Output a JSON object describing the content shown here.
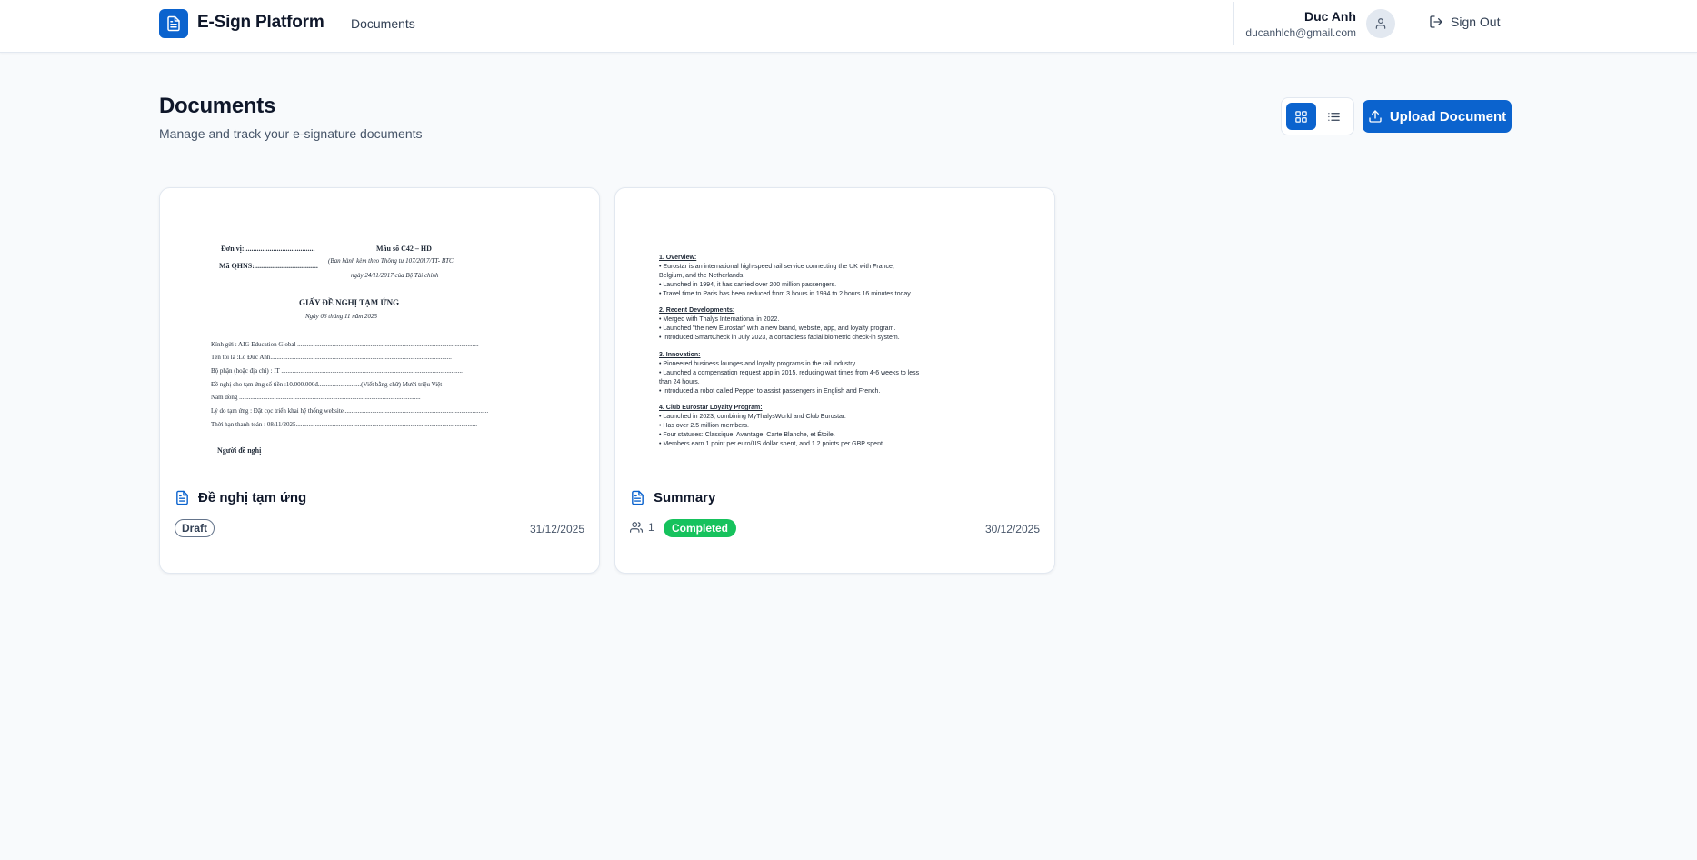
{
  "header": {
    "brand": "E-Sign Platform",
    "nav_documents": "Documents",
    "user_name": "Duc Anh",
    "user_email": "ducanhlch@gmail.com",
    "sign_out": "Sign Out"
  },
  "page": {
    "title": "Documents",
    "subtitle": "Manage and track your e-signature documents",
    "upload_label": "Upload Document"
  },
  "documents": [
    {
      "title": "Đề nghị tạm ứng",
      "status": "Draft",
      "date": "31/12/2025",
      "preview": {
        "unit": "Đơn vị:.......................................",
        "code": "Mã QHNS:...................................",
        "form_no": "Mẫu số C42 – HD",
        "issued_1": "(Ban hành kèm theo Thông tư 107/2017/TT- BTC",
        "issued_2": "ngày 24/11/2017 của Bộ Tài chính",
        "heading": "GIẤY ĐỀ NGHỊ TẠM ỨNG",
        "dated": "Ngày 06 tháng 11 năm 2025",
        "lines": [
          "Kính gửi : AIG Education Global ..................................................................................................................",
          "Tên tôi là :Lò Đức Anh..................................................................................................................",
          "Bộ phận (hoặc địa chỉ) : IT ..................................................................................................................",
          "Đề nghị cho tạm ứng số tiền :10.000.000đ...........................(Viết bằng chữ) Mười triệu Việt",
          "Nam đồng ..................................................................................................................",
          "Lý do tạm ứng : Đặt cọc triển khai hệ thống website..................................................................................................................",
          "Thời hạn thanh toán : 08/11/2025..................................................................................................................",
          "Người đề nghị"
        ]
      }
    },
    {
      "title": "Summary",
      "status": "Completed",
      "date": "30/12/2025",
      "signers": "1",
      "preview": {
        "lines": [
          {
            "text": "1. Overview:",
            "h": true
          },
          {
            "text": "• Eurostar is an international high-speed rail service connecting the UK with France,",
            "h": false
          },
          {
            "text": "Belgium, and the Netherlands.",
            "h": false
          },
          {
            "text": "• Launched in 1994, it has carried over 200 million passengers.",
            "h": false
          },
          {
            "text": "• Travel time to Paris has been reduced from 3 hours in 1994 to 2 hours 16 minutes today.",
            "h": false
          },
          {
            "text": "",
            "h": false
          },
          {
            "text": "2. Recent Developments:",
            "h": true
          },
          {
            "text": "• Merged with Thalys International in 2022.",
            "h": false
          },
          {
            "text": "• Launched \"the new Eurostar\" with a new brand, website, app, and loyalty program.",
            "h": false
          },
          {
            "text": "• Introduced SmartCheck in July 2023, a contactless facial biometric check-in system.",
            "h": false
          },
          {
            "text": "",
            "h": false
          },
          {
            "text": "3. Innovation:",
            "h": true
          },
          {
            "text": "• Pioneered business lounges and loyalty programs in the rail industry.",
            "h": false
          },
          {
            "text": "• Launched a compensation request app in 2015, reducing wait times from 4-6 weeks to less",
            "h": false
          },
          {
            "text": "than 24 hours.",
            "h": false
          },
          {
            "text": "• Introduced a robot called Pepper to assist passengers in English and French.",
            "h": false
          },
          {
            "text": "",
            "h": false
          },
          {
            "text": "4. Club Eurostar Loyalty Program:",
            "h": true
          },
          {
            "text": "• Launched in 2023, combining MyThalysWorld and Club Eurostar.",
            "h": false
          },
          {
            "text": "• Has over 2.5 million members.",
            "h": false
          },
          {
            "text": "• Four statuses: Classique, Avantage, Carte Blanche, et Étoile.",
            "h": false
          },
          {
            "text": "• Members earn 1 point per euro/US dollar spent, and 1.2 points per GBP spent.",
            "h": false
          }
        ]
      }
    }
  ],
  "icons": {
    "logo": "document-icon",
    "avatar": "user-icon",
    "sign_out": "logout-icon",
    "grid_view": "grid-icon",
    "list_view": "list-icon",
    "upload": "upload-icon",
    "file": "file-text-icon",
    "signers": "users-icon"
  },
  "colors": {
    "primary": "#0b63ce",
    "completed": "#16c25d",
    "background": "#f8fafc"
  }
}
